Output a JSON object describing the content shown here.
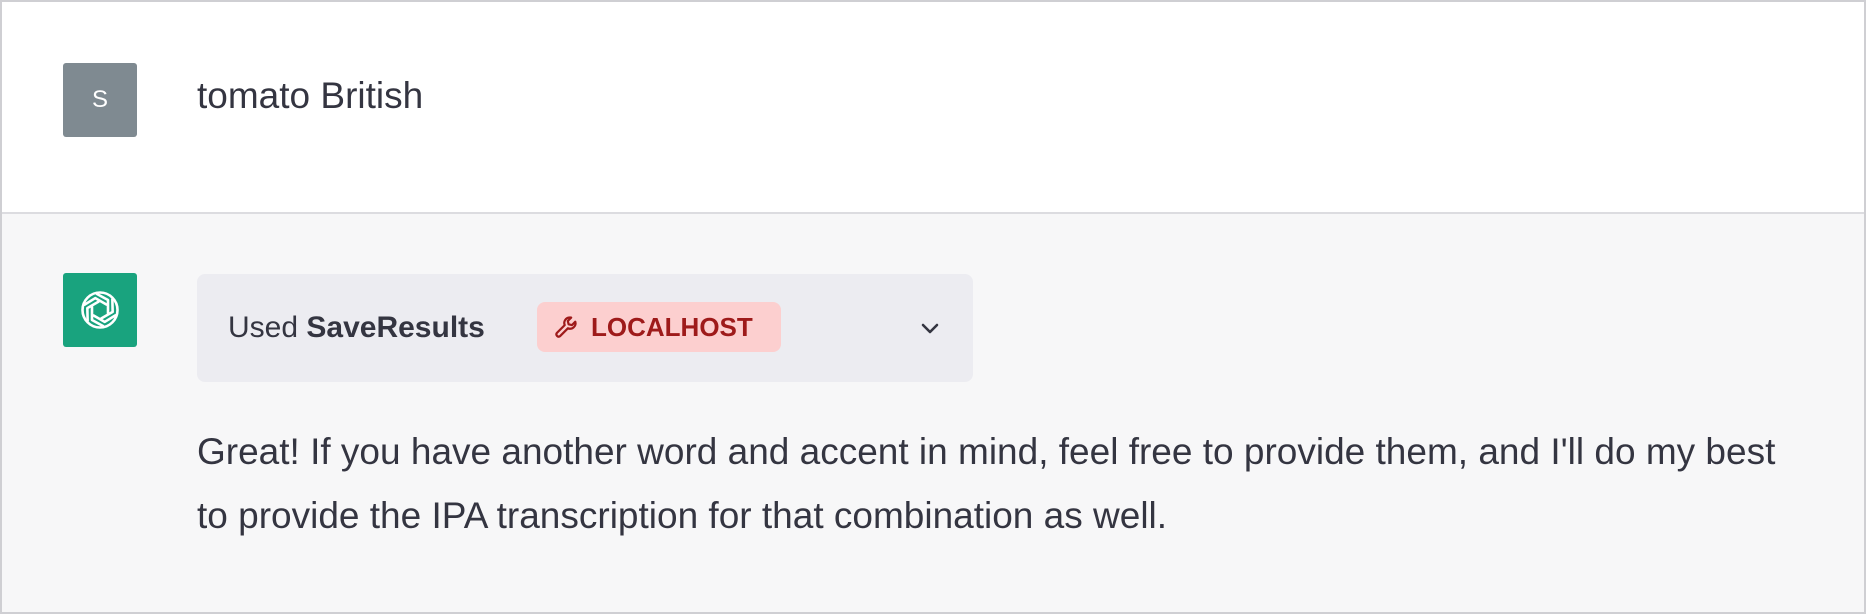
{
  "user_message": {
    "avatar_initial": "S",
    "text": "tomato British"
  },
  "assistant_message": {
    "avatar_icon": "openai-logo-icon",
    "tool_card": {
      "used_prefix": "Used",
      "plugin_name": "SaveResults",
      "badge_icon": "wrench-icon",
      "badge_label": "LOCALHOST",
      "toggle_icon": "chevron-down-icon"
    },
    "response_text": "Great! If you have another word and accent in mind, feel free to provide them, and I'll do my best to provide the IPA transcription for that combination as well."
  },
  "colors": {
    "user_avatar_bg": "#7f8a91",
    "assistant_avatar_bg": "#19a37e",
    "badge_bg": "#fccfcf",
    "badge_text": "#9e1a1a",
    "assistant_row_bg": "#f7f7f8"
  }
}
